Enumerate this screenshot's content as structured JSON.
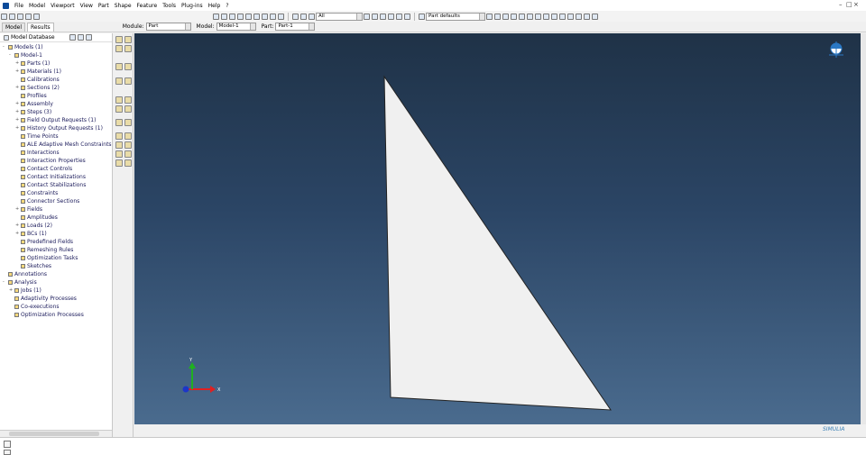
{
  "menu": {
    "items": [
      "File",
      "Model",
      "Viewport",
      "View",
      "Part",
      "Shape",
      "Feature",
      "Tools",
      "Plug-ins",
      "Help",
      "?"
    ]
  },
  "toolbar": {
    "render_select": "All",
    "part_defaults": "Part defaults"
  },
  "modulebar": {
    "tabs": [
      "Model",
      "Results"
    ],
    "module_label": "Module:",
    "module_value": "Part",
    "model_label": "Model:",
    "model_value": "Model-1",
    "part_label": "Part:",
    "part_value": "Part-1"
  },
  "tree": {
    "header": "Model Database",
    "rows": [
      {
        "toggle": "-",
        "label": "Models (1)",
        "indent": 0
      },
      {
        "toggle": "-",
        "label": "Model-1",
        "indent": 1
      },
      {
        "toggle": "+",
        "label": "Parts (1)",
        "indent": 2
      },
      {
        "toggle": "+",
        "label": "Materials (1)",
        "indent": 2
      },
      {
        "toggle": "",
        "label": "Calibrations",
        "indent": 2
      },
      {
        "toggle": "+",
        "label": "Sections (2)",
        "indent": 2
      },
      {
        "toggle": "",
        "label": "Profiles",
        "indent": 2
      },
      {
        "toggle": "+",
        "label": "Assembly",
        "indent": 2
      },
      {
        "toggle": "+",
        "label": "Steps (3)",
        "indent": 2
      },
      {
        "toggle": "+",
        "label": "Field Output Requests (1)",
        "indent": 2
      },
      {
        "toggle": "+",
        "label": "History Output Requests (1)",
        "indent": 2
      },
      {
        "toggle": "",
        "label": "Time Points",
        "indent": 2
      },
      {
        "toggle": "",
        "label": "ALE Adaptive Mesh Constraints",
        "indent": 2
      },
      {
        "toggle": "",
        "label": "Interactions",
        "indent": 2
      },
      {
        "toggle": "",
        "label": "Interaction Properties",
        "indent": 2
      },
      {
        "toggle": "",
        "label": "Contact Controls",
        "indent": 2
      },
      {
        "toggle": "",
        "label": "Contact Initializations",
        "indent": 2
      },
      {
        "toggle": "",
        "label": "Contact Stabilizations",
        "indent": 2
      },
      {
        "toggle": "",
        "label": "Constraints",
        "indent": 2
      },
      {
        "toggle": "",
        "label": "Connector Sections",
        "indent": 2
      },
      {
        "toggle": "+",
        "label": "Fields",
        "indent": 2
      },
      {
        "toggle": "",
        "label": "Amplitudes",
        "indent": 2
      },
      {
        "toggle": "+",
        "label": "Loads (2)",
        "indent": 2
      },
      {
        "toggle": "+",
        "label": "BCs (1)",
        "indent": 2
      },
      {
        "toggle": "",
        "label": "Predefined Fields",
        "indent": 2
      },
      {
        "toggle": "",
        "label": "Remeshing Rules",
        "indent": 2
      },
      {
        "toggle": "",
        "label": "Optimization Tasks",
        "indent": 2
      },
      {
        "toggle": "",
        "label": "Sketches",
        "indent": 2
      },
      {
        "toggle": "",
        "label": "Annotations",
        "indent": 0
      },
      {
        "toggle": "-",
        "label": "Analysis",
        "indent": 0
      },
      {
        "toggle": "+",
        "label": "Jobs (1)",
        "indent": 1
      },
      {
        "toggle": "",
        "label": "Adaptivity Processes",
        "indent": 1
      },
      {
        "toggle": "",
        "label": "Co-executions",
        "indent": 1
      },
      {
        "toggle": "",
        "label": "Optimization Processes",
        "indent": 1
      }
    ]
  },
  "viewport": {
    "triad": {
      "x_label": "X",
      "y_label": "Y"
    },
    "brand": "SIMULIA"
  },
  "colors": {
    "viewport_top": "#1f3247",
    "viewport_bottom": "#4a6b8e",
    "part_fill": "#f0f0f0"
  }
}
